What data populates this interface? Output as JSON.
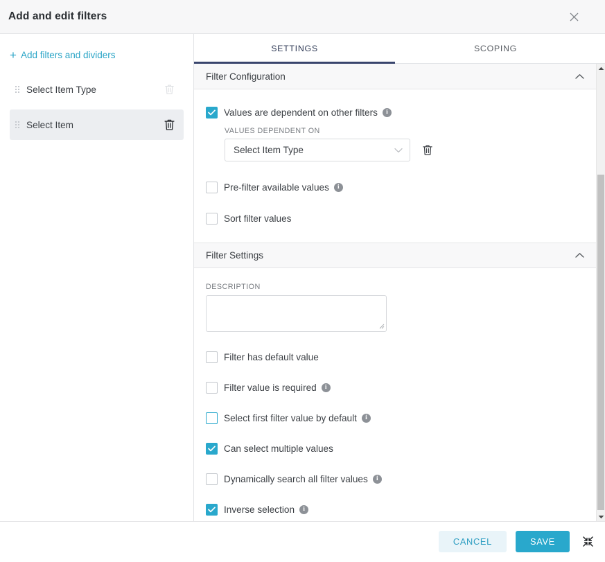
{
  "dialog": {
    "title": "Add and edit filters",
    "close_icon": "close-icon"
  },
  "sidebar": {
    "add_link": "Add filters and dividers",
    "add_icon": "plus-icon",
    "items": [
      {
        "label": "Select Item Type",
        "selected": false,
        "drag_icon": "drag-handle-icon",
        "delete_icon": "trash-icon"
      },
      {
        "label": "Select Item",
        "selected": true,
        "drag_icon": "drag-handle-icon",
        "delete_icon": "trash-icon"
      }
    ]
  },
  "tabs": [
    {
      "label": "SETTINGS",
      "active": true
    },
    {
      "label": "SCOPING",
      "active": false
    }
  ],
  "sections": {
    "filter_configuration": {
      "title": "Filter Configuration",
      "collapse_icon": "chevron-up-icon",
      "options": [
        {
          "label": "Values are dependent on other filters",
          "checked": true,
          "info": true
        },
        {
          "label": "Pre-filter available values",
          "checked": false,
          "info": true
        },
        {
          "label": "Sort filter values",
          "checked": false,
          "info": false
        }
      ],
      "dependent_on": {
        "label": "VALUES DEPENDENT ON",
        "value": "Select Item Type",
        "caret_icon": "chevron-down-icon",
        "delete_icon": "trash-icon"
      }
    },
    "filter_settings": {
      "title": "Filter Settings",
      "collapse_icon": "chevron-up-icon",
      "description": {
        "label": "DESCRIPTION",
        "value": "",
        "placeholder": ""
      },
      "options": [
        {
          "label": "Filter has default value",
          "checked": false,
          "info": false,
          "focused": false
        },
        {
          "label": "Filter value is required",
          "checked": false,
          "info": true,
          "focused": false
        },
        {
          "label": "Select first filter value by default",
          "checked": false,
          "info": true,
          "focused": true
        },
        {
          "label": "Can select multiple values",
          "checked": true,
          "info": false,
          "focused": false
        },
        {
          "label": "Dynamically search all filter values",
          "checked": false,
          "info": true,
          "focused": false
        },
        {
          "label": "Inverse selection",
          "checked": true,
          "info": true,
          "focused": false
        }
      ]
    }
  },
  "scrollbar": {
    "up_icon": "scroll-up-arrow-icon",
    "down_icon": "scroll-down-arrow-icon"
  },
  "footer": {
    "cancel_label": "CANCEL",
    "save_label": "SAVE",
    "resize_icon": "shrink-arrows-icon"
  },
  "colors": {
    "accent": "#29a8cc",
    "link": "#29a4c6",
    "tab_active_underline": "#39456d",
    "cancel_bg": "#e9f4f9"
  }
}
